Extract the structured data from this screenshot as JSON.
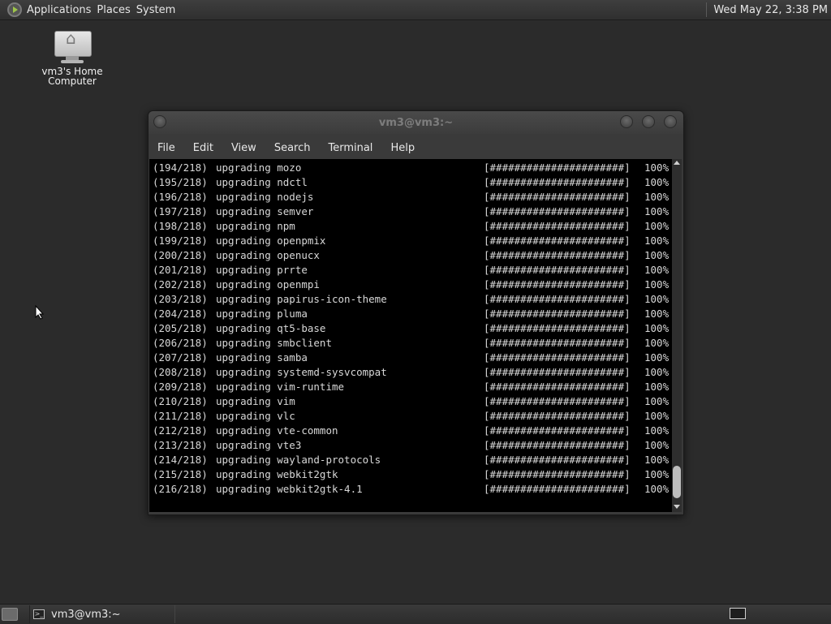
{
  "top_panel": {
    "menus": [
      "Applications",
      "Places",
      "System"
    ],
    "clock": "Wed May 22,  3:38 PM"
  },
  "desktop": {
    "icon_label_line1": "vm3's Home",
    "icon_label_line2": "Computer"
  },
  "terminal": {
    "title": "vm3@vm3:~",
    "menu": [
      "File",
      "Edit",
      "View",
      "Search",
      "Terminal",
      "Help"
    ],
    "progress_bar": "[######################]",
    "percent": "100%",
    "lines": [
      {
        "idx": "(194/218)",
        "text": "upgrading mozo"
      },
      {
        "idx": "(195/218)",
        "text": "upgrading ndctl"
      },
      {
        "idx": "(196/218)",
        "text": "upgrading nodejs"
      },
      {
        "idx": "(197/218)",
        "text": "upgrading semver"
      },
      {
        "idx": "(198/218)",
        "text": "upgrading npm"
      },
      {
        "idx": "(199/218)",
        "text": "upgrading openpmix"
      },
      {
        "idx": "(200/218)",
        "text": "upgrading openucx"
      },
      {
        "idx": "(201/218)",
        "text": "upgrading prrte"
      },
      {
        "idx": "(202/218)",
        "text": "upgrading openmpi"
      },
      {
        "idx": "(203/218)",
        "text": "upgrading papirus-icon-theme"
      },
      {
        "idx": "(204/218)",
        "text": "upgrading pluma"
      },
      {
        "idx": "(205/218)",
        "text": "upgrading qt5-base"
      },
      {
        "idx": "(206/218)",
        "text": "upgrading smbclient"
      },
      {
        "idx": "(207/218)",
        "text": "upgrading samba"
      },
      {
        "idx": "(208/218)",
        "text": "upgrading systemd-sysvcompat"
      },
      {
        "idx": "(209/218)",
        "text": "upgrading vim-runtime"
      },
      {
        "idx": "(210/218)",
        "text": "upgrading vim"
      },
      {
        "idx": "(211/218)",
        "text": "upgrading vlc"
      },
      {
        "idx": "(212/218)",
        "text": "upgrading vte-common"
      },
      {
        "idx": "(213/218)",
        "text": "upgrading vte3"
      },
      {
        "idx": "(214/218)",
        "text": "upgrading wayland-protocols"
      },
      {
        "idx": "(215/218)",
        "text": "upgrading webkit2gtk"
      },
      {
        "idx": "(216/218)",
        "text": "upgrading webkit2gtk-4.1"
      }
    ]
  },
  "taskbar": {
    "task_label": "vm3@vm3:~"
  }
}
